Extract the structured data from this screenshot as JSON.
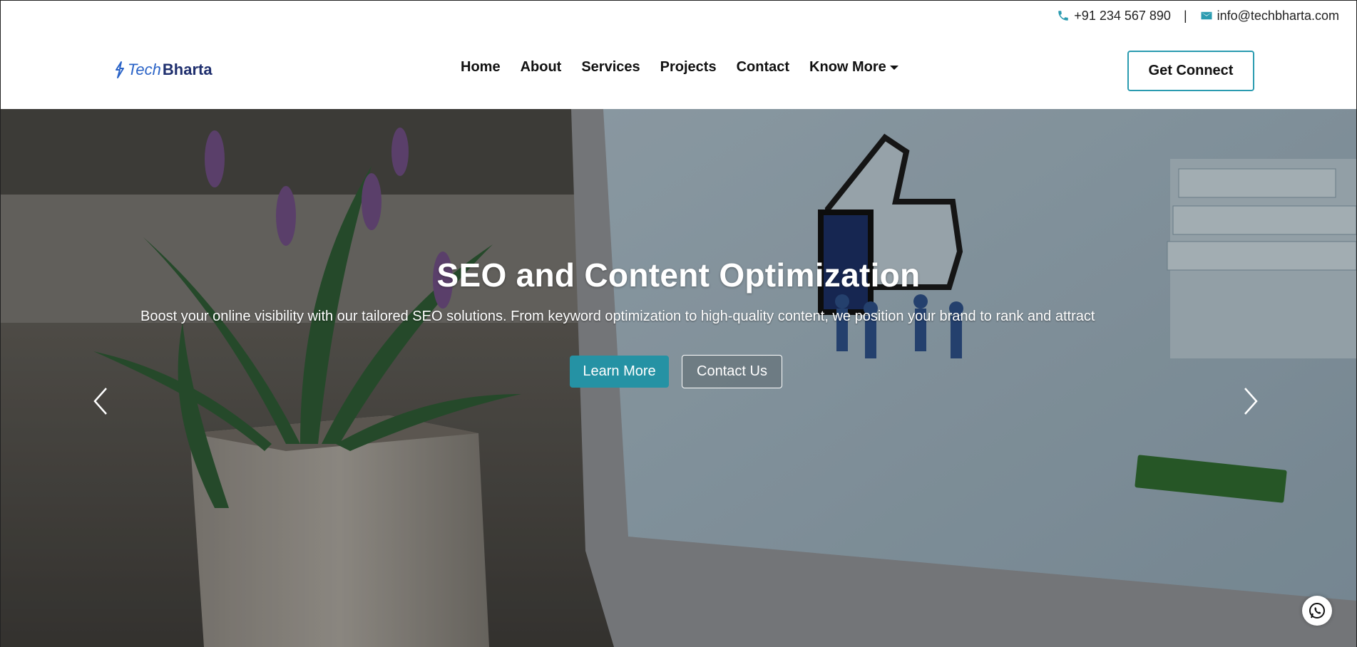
{
  "topbar": {
    "phone": "+91 234 567 890",
    "separator": "|",
    "email": "info@techbharta.com"
  },
  "logo": {
    "part1": "Tech",
    "part2": "Bharta"
  },
  "nav": {
    "items": [
      "Home",
      "About",
      "Services",
      "Projects",
      "Contact",
      "Know More"
    ]
  },
  "header": {
    "cta_label": "Get Connect"
  },
  "hero": {
    "title": "SEO and Content Optimization",
    "subtitle": "Boost your online visibility with our tailored SEO solutions. From keyword optimization to high-quality content, we position your brand to rank and attract",
    "primary_button": "Learn More",
    "secondary_button": "Contact Us"
  },
  "icons": {
    "phone": "phone-icon",
    "email": "mail-icon",
    "dropdown": "caret-down-icon",
    "prev": "chevron-left-icon",
    "next": "chevron-right-icon",
    "whatsapp": "whatsapp-icon"
  },
  "colors": {
    "accent": "#2592a4",
    "logo_blue": "#2a63c7",
    "logo_navy": "#1f2f6e"
  }
}
